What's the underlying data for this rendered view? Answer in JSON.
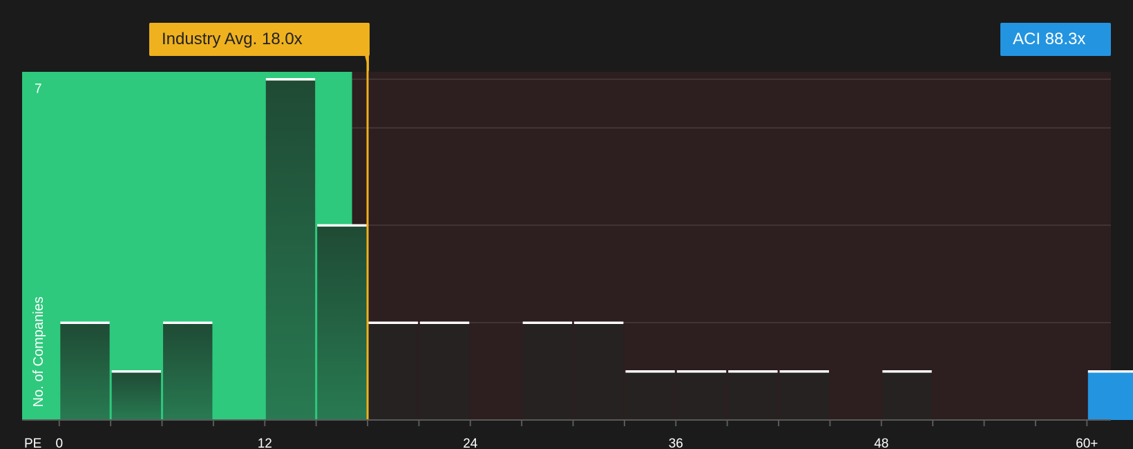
{
  "chart_data": {
    "type": "bar",
    "xlabel": "PE",
    "ylabel": "No. of Companies",
    "x_ticks": [
      0,
      12,
      24,
      36,
      48,
      60
    ],
    "x_tick_labels": [
      "0",
      "12",
      "24",
      "36",
      "48",
      "60+"
    ],
    "xlim": [
      -2.17,
      61.4
    ],
    "ylim": [
      0,
      7.15
    ],
    "y_tick_label_values": [
      7
    ],
    "y_gridlines": [
      2,
      4,
      6,
      7
    ],
    "bin_width": 3,
    "bins": [
      {
        "start": 0,
        "count": 2
      },
      {
        "start": 3,
        "count": 1
      },
      {
        "start": 6,
        "count": 2
      },
      {
        "start": 9,
        "count": 0
      },
      {
        "start": 12,
        "count": 7
      },
      {
        "start": 15,
        "count": 4
      },
      {
        "start": 18,
        "count": 2
      },
      {
        "start": 21,
        "count": 2
      },
      {
        "start": 24,
        "count": 0
      },
      {
        "start": 27,
        "count": 2
      },
      {
        "start": 30,
        "count": 2
      },
      {
        "start": 33,
        "count": 1
      },
      {
        "start": 36,
        "count": 1
      },
      {
        "start": 39,
        "count": 1
      },
      {
        "start": 42,
        "count": 1
      },
      {
        "start": 45,
        "count": 0
      },
      {
        "start": 48,
        "count": 1
      },
      {
        "start": 51,
        "count": 0
      },
      {
        "start": 54,
        "count": 0
      },
      {
        "start": 57,
        "count": 0
      },
      {
        "start": 60,
        "count": 1,
        "highlight": true
      }
    ],
    "industry_avg": {
      "value": 18.0,
      "label": "Industry Avg. 18.0x"
    },
    "company": {
      "ticker": "ACI",
      "value": 88.3,
      "label": "ACI 88.3x"
    },
    "colors": {
      "background": "#1b1b1b",
      "below_avg_region": "#2ec97d",
      "above_avg_region": "#2d1e1f",
      "bar_below": "#1f5c3c",
      "bar_above": "#262222",
      "bar_cap": "#ffffff",
      "avg_line": "#efb11d",
      "company": "#2394e0",
      "gridline": "#4a3b3c"
    }
  }
}
